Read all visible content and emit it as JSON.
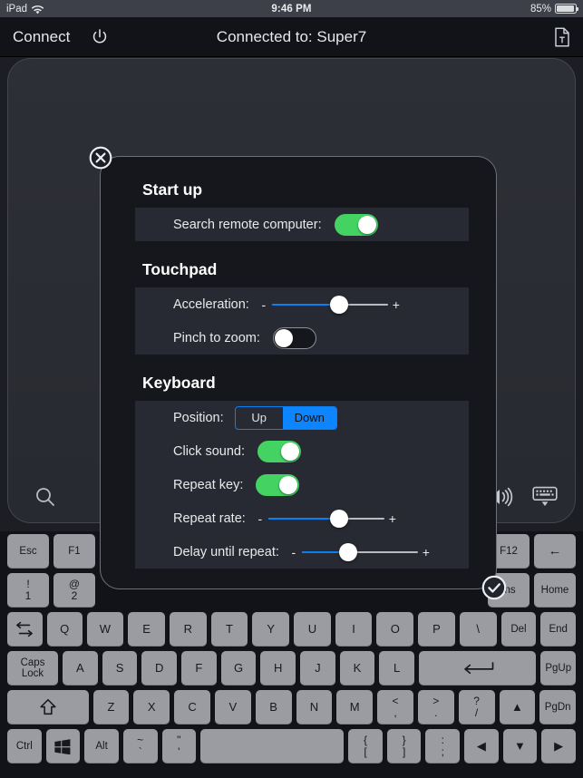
{
  "status_bar": {
    "device": "iPad",
    "wifi_icon": "wifi-icon",
    "time": "9:46 PM",
    "battery_percent": "85%",
    "battery_icon": "battery-icon"
  },
  "nav_bar": {
    "connect_label": "Connect",
    "power_icon": "power-icon",
    "title": "Connected to: Super7",
    "document_icon": "document-icon"
  },
  "touchpad": {
    "search_icon": "search-icon",
    "speaker_icon": "speaker-icon",
    "hide_keyboard_icon": "keyboard-hide-icon"
  },
  "dialog": {
    "close_icon": "close-circle-icon",
    "confirm_icon": "check-circle-icon",
    "accent_green": "#44d362",
    "accent_blue": "#0a7ff2",
    "sections": [
      {
        "title": "Start up",
        "rows": [
          {
            "label": "Search remote computer:",
            "control": "toggle",
            "value": "on"
          }
        ]
      },
      {
        "title": "Touchpad",
        "rows": [
          {
            "label": "Acceleration:",
            "control": "slider",
            "minus": "-",
            "plus": "+",
            "value": 58
          },
          {
            "label": "Pinch to zoom:",
            "control": "toggle",
            "value": "off"
          }
        ]
      },
      {
        "title": "Keyboard",
        "rows": [
          {
            "label": "Position:",
            "control": "segmented",
            "options": [
              "Up",
              "Down"
            ],
            "selected": "Down"
          },
          {
            "label": "Click sound:",
            "control": "toggle",
            "value": "on"
          },
          {
            "label": "Repeat key:",
            "control": "toggle",
            "value": "on"
          },
          {
            "label": "Repeat rate:",
            "control": "slider",
            "minus": "-",
            "plus": "+",
            "value": 61
          },
          {
            "label": "Delay until repeat:",
            "control": "slider",
            "minus": "-",
            "plus": "+",
            "value": 40
          }
        ]
      }
    ]
  },
  "keyboard": {
    "row_fn": [
      "Esc",
      "F1",
      "F12",
      "←"
    ],
    "row_num": [
      "!\n1",
      "@\n2",
      "Ins",
      "Home"
    ],
    "row_q": [
      "⇤⇥",
      "Q",
      "W",
      "E",
      "R",
      "T",
      "Y",
      "U",
      "I",
      "O",
      "P",
      "\\",
      "Del",
      "End"
    ],
    "row_a": [
      "Caps Lock",
      "A",
      "S",
      "D",
      "F",
      "G",
      "H",
      "J",
      "K",
      "L",
      "↵",
      "PgUp"
    ],
    "row_z": [
      "⇧",
      "Z",
      "X",
      "C",
      "V",
      "B",
      "N",
      "M",
      "<\n,",
      ">\n.",
      "?\n/",
      "▲",
      "PgDn"
    ],
    "row_ctrl": [
      "Ctrl",
      "win",
      "Alt",
      "~\n`",
      "\"\n'",
      "space",
      "{\n[",
      "}\n]",
      ":\n;",
      "◀",
      "▼",
      "▶"
    ]
  }
}
